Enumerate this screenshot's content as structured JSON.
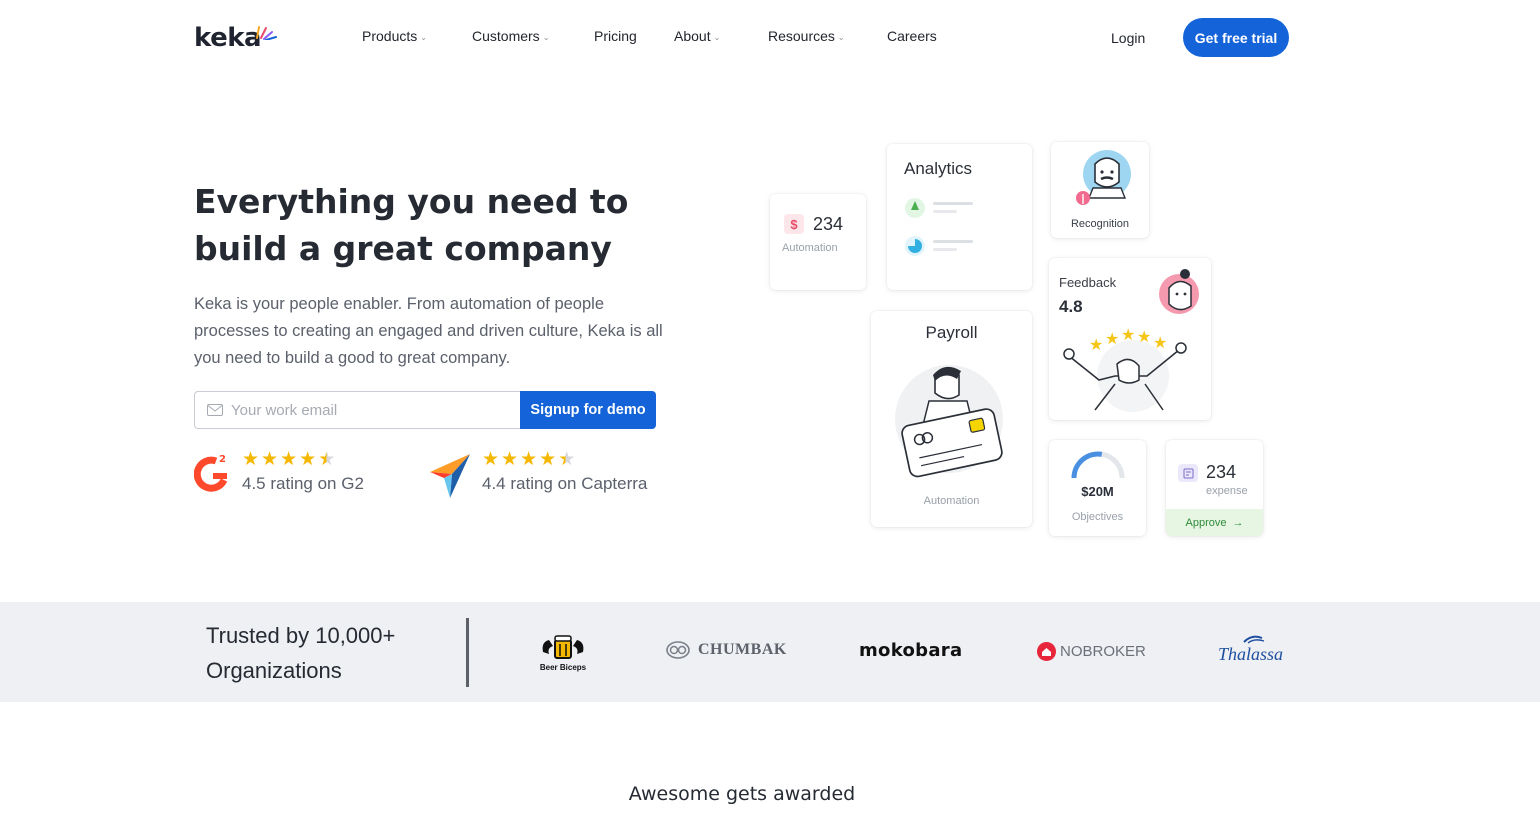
{
  "brand": {
    "logo_text": "keka"
  },
  "nav": {
    "items": [
      {
        "label": "Products",
        "has_dropdown": true
      },
      {
        "label": "Customers",
        "has_dropdown": true
      },
      {
        "label": "Pricing",
        "has_dropdown": false
      },
      {
        "label": "About",
        "has_dropdown": true
      },
      {
        "label": "Resources",
        "has_dropdown": true
      },
      {
        "label": "Careers",
        "has_dropdown": false
      }
    ],
    "login_label": "Login",
    "cta_label": "Get free trial"
  },
  "hero": {
    "title_line1": "Everything you need to",
    "title_line2": "build a great company",
    "subtitle": "Keka is your people enabler. From automation of people processes to creating an engaged and driven culture, Keka is all you need to build a good to great company.",
    "email_placeholder": "Your work email",
    "signup_label": "Signup for demo",
    "ratings": [
      {
        "source": "G2",
        "score": 4.5,
        "text": "4.5 rating on G2"
      },
      {
        "source": "Capterra",
        "score": 4.4,
        "text": "4.4 rating on Capterra"
      }
    ]
  },
  "cards": {
    "automation": {
      "value": "234",
      "label": "Automation"
    },
    "analytics": {
      "title": "Analytics"
    },
    "recognition": {
      "label": "Recognition"
    },
    "feedback": {
      "title": "Feedback",
      "score": "4.8"
    },
    "payroll": {
      "title": "Payroll",
      "label": "Automation"
    },
    "objectives": {
      "value": "$20M",
      "label": "Objectives",
      "progress": 0.55
    },
    "expense": {
      "value": "234",
      "label": "expense",
      "action": "Approve"
    }
  },
  "trusted": {
    "line1": "Trusted by 10,000+",
    "line2": "Organizations",
    "logos": [
      "Beer Biceps",
      "CHUMBAK",
      "mokobara",
      "NOBROKER",
      "Thalassa"
    ]
  },
  "awarded_heading": "Awesome gets awarded",
  "colors": {
    "primary": "#1463d8",
    "star": "#f5b800",
    "g2_red": "#ff492c",
    "approve_bg": "#e6f6e2",
    "approve_text": "#2e8b3a"
  }
}
